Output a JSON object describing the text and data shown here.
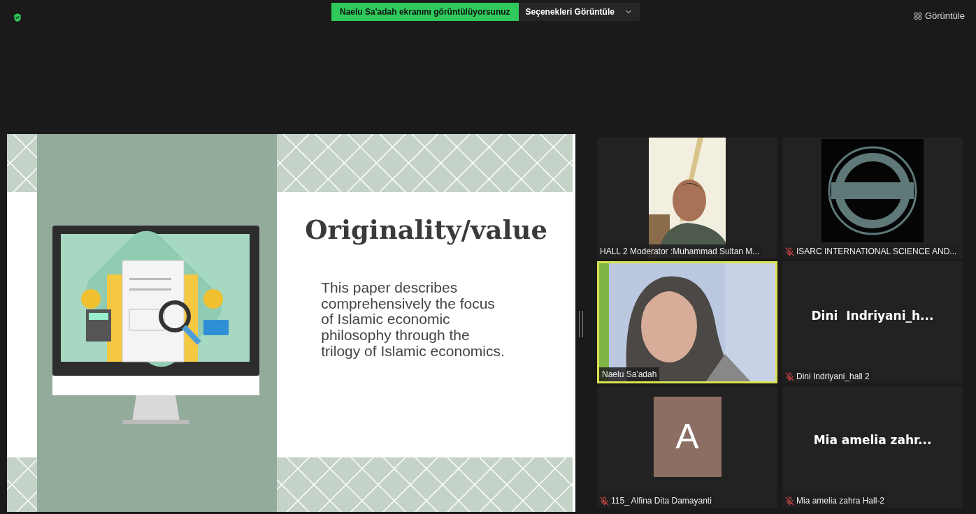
{
  "top_bar": {
    "share_banner": "Naelu Sa'adah ekranını görüntülüyorsunuz",
    "options_button": "Seçenekleri Görüntüle",
    "view_button": "Görüntüle"
  },
  "slide": {
    "title": "Originality/value",
    "body": "This paper describes comprehensively the focus of Islamic economic philosophy through the trilogy of Islamic economics."
  },
  "participants": [
    {
      "kind": "picture",
      "name": "HALL 2 Moderator :Muhammad Sultan M...",
      "muted": false,
      "speaking": false
    },
    {
      "kind": "picture",
      "name": "ISARC INTERNATIONAL SCIENCE AND...",
      "muted": true,
      "speaking": false
    },
    {
      "kind": "picture",
      "name": "Naelu Sa'adah",
      "muted": false,
      "speaking": true
    },
    {
      "kind": "name",
      "display_name": "Dini  Indriyani_h...",
      "name": "Dini Indriyani_hall 2",
      "muted": true,
      "speaking": false
    },
    {
      "kind": "avatar",
      "avatar_letter": "A",
      "color": "#8b6f63",
      "name": "115_ Alfina Dita Damayanti",
      "muted": true,
      "speaking": false
    },
    {
      "kind": "name",
      "display_name": "Mia amelia zahr...",
      "name": "Mia amelia zahra Hall-2",
      "muted": true,
      "speaking": false
    }
  ]
}
